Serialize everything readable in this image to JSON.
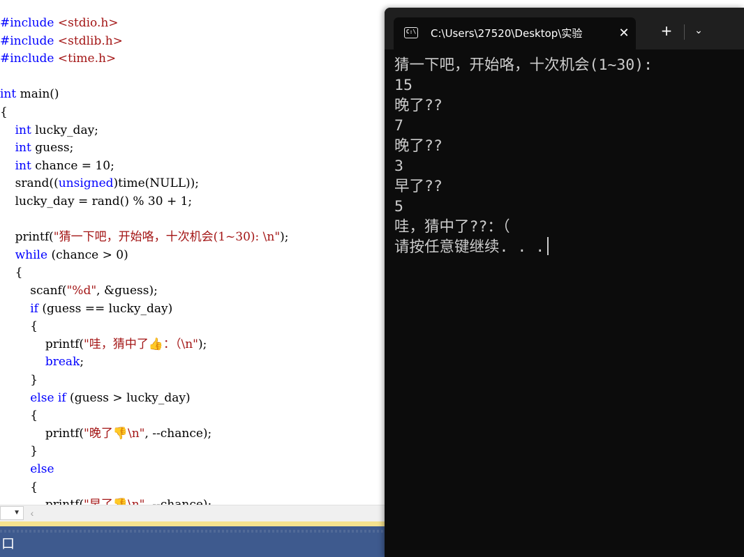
{
  "editor": {
    "lines": [
      {
        "segments": [
          {
            "t": "#include ",
            "c": "kw"
          },
          {
            "t": "<stdio.h>",
            "c": "str"
          }
        ]
      },
      {
        "segments": [
          {
            "t": "#include ",
            "c": "kw"
          },
          {
            "t": "<stdlib.h>",
            "c": "str"
          }
        ]
      },
      {
        "segments": [
          {
            "t": "#include ",
            "c": "kw"
          },
          {
            "t": "<time.h>",
            "c": "str"
          }
        ]
      },
      {
        "segments": []
      },
      {
        "segments": [
          {
            "t": "int",
            "c": "kw"
          },
          {
            "t": " main()",
            "c": ""
          }
        ]
      },
      {
        "segments": [
          {
            "t": "{",
            "c": ""
          }
        ]
      },
      {
        "segments": [
          {
            "t": "    ",
            "c": ""
          },
          {
            "t": "int",
            "c": "kw"
          },
          {
            "t": " lucky_day;",
            "c": ""
          }
        ]
      },
      {
        "segments": [
          {
            "t": "    ",
            "c": ""
          },
          {
            "t": "int",
            "c": "kw"
          },
          {
            "t": " guess;",
            "c": ""
          }
        ]
      },
      {
        "segments": [
          {
            "t": "    ",
            "c": ""
          },
          {
            "t": "int",
            "c": "kw"
          },
          {
            "t": " chance = 10;",
            "c": ""
          }
        ]
      },
      {
        "segments": [
          {
            "t": "    srand((",
            "c": ""
          },
          {
            "t": "unsigned",
            "c": "kw"
          },
          {
            "t": ")time(NULL));",
            "c": ""
          }
        ]
      },
      {
        "segments": [
          {
            "t": "    lucky_day = rand() % 30 + 1;",
            "c": ""
          }
        ]
      },
      {
        "segments": []
      },
      {
        "segments": [
          {
            "t": "    printf(",
            "c": ""
          },
          {
            "t": "\"猜一下吧，开始咯，十次机会(1~30): \\n\"",
            "c": "str"
          },
          {
            "t": ");",
            "c": ""
          }
        ]
      },
      {
        "segments": [
          {
            "t": "    ",
            "c": ""
          },
          {
            "t": "while",
            "c": "kw"
          },
          {
            "t": " (chance > 0)",
            "c": ""
          }
        ]
      },
      {
        "segments": [
          {
            "t": "    {",
            "c": ""
          }
        ]
      },
      {
        "segments": [
          {
            "t": "        scanf(",
            "c": ""
          },
          {
            "t": "\"%d\"",
            "c": "str"
          },
          {
            "t": ", &guess);",
            "c": ""
          }
        ]
      },
      {
        "segments": [
          {
            "t": "        ",
            "c": ""
          },
          {
            "t": "if",
            "c": "kw"
          },
          {
            "t": " (guess == lucky_day)",
            "c": ""
          }
        ]
      },
      {
        "segments": [
          {
            "t": "        {",
            "c": ""
          }
        ]
      },
      {
        "segments": [
          {
            "t": "            printf(",
            "c": ""
          },
          {
            "t": "\"哇，猜中了👍：（\\n\"",
            "c": "str"
          },
          {
            "t": ");",
            "c": ""
          }
        ]
      },
      {
        "segments": [
          {
            "t": "            ",
            "c": ""
          },
          {
            "t": "break",
            "c": "kw"
          },
          {
            "t": ";",
            "c": ""
          }
        ]
      },
      {
        "segments": [
          {
            "t": "        }",
            "c": ""
          }
        ]
      },
      {
        "segments": [
          {
            "t": "        ",
            "c": ""
          },
          {
            "t": "else if",
            "c": "kw"
          },
          {
            "t": " (guess > lucky_day)",
            "c": ""
          }
        ]
      },
      {
        "segments": [
          {
            "t": "        {",
            "c": ""
          }
        ]
      },
      {
        "segments": [
          {
            "t": "            printf(",
            "c": ""
          },
          {
            "t": "\"晚了👎\\n\"",
            "c": "str"
          },
          {
            "t": ", --chance);",
            "c": ""
          }
        ]
      },
      {
        "segments": [
          {
            "t": "        }",
            "c": ""
          }
        ]
      },
      {
        "segments": [
          {
            "t": "        ",
            "c": ""
          },
          {
            "t": "else",
            "c": "kw"
          }
        ]
      },
      {
        "segments": [
          {
            "t": "        {",
            "c": ""
          }
        ]
      },
      {
        "segments": [
          {
            "t": "            printf(",
            "c": ""
          },
          {
            "t": "\"早了👎\\n\"",
            "c": "str"
          },
          {
            "t": ", --chance);",
            "c": ""
          }
        ]
      }
    ],
    "status_glyph": "口"
  },
  "terminal": {
    "tab_title": "C:\\Users\\27520\\Desktop\\实验",
    "tab_icon_text": "C:\\",
    "close_glyph": "✕",
    "new_tab_glyph": "+",
    "dropdown_glyph": "⌄",
    "output": [
      "猜一下吧，开始咯，十次机会(1~30):",
      "15",
      "晚了??",
      "7",
      "晚了??",
      "3",
      "早了??",
      "5",
      "哇，猜中了??：（",
      "请按任意键继续. . ."
    ]
  },
  "colors": {
    "keyword": "#0000ff",
    "string": "#a31515",
    "terminal_bg": "#0c0c0c",
    "terminal_text": "#cccccc",
    "status_bar": "#3e5a8e"
  }
}
